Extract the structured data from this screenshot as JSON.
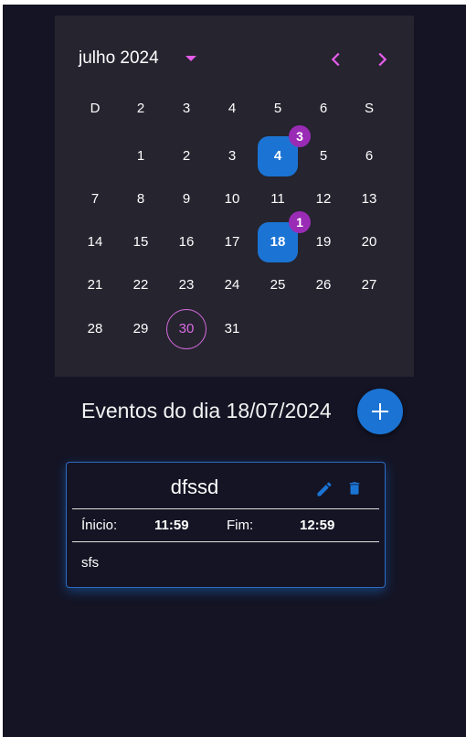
{
  "calendar": {
    "month_label": "julho 2024",
    "weekdays": [
      "D",
      "2",
      "3",
      "4",
      "5",
      "6",
      "S"
    ],
    "weeks": [
      [
        "",
        "1",
        "2",
        "3",
        "4",
        "5",
        "6"
      ],
      [
        "7",
        "8",
        "9",
        "10",
        "11",
        "12",
        "13"
      ],
      [
        "14",
        "15",
        "16",
        "17",
        "18",
        "19",
        "20"
      ],
      [
        "21",
        "22",
        "23",
        "24",
        "25",
        "26",
        "27"
      ],
      [
        "28",
        "29",
        "30",
        "31",
        "",
        "",
        ""
      ]
    ],
    "event_days": [
      {
        "day": "4",
        "count": "3"
      },
      {
        "day": "18",
        "count": "1"
      }
    ],
    "today": "30",
    "selected": "18"
  },
  "events": {
    "title": "Eventos do dia 18/07/2024",
    "add_icon": "plus-icon",
    "items": [
      {
        "title": "dfssd",
        "start_label": "Ínicio:",
        "start": "11:59",
        "end_label": "Fim:",
        "end": "12:59",
        "description": "sfs"
      }
    ]
  },
  "colors": {
    "background": "#141424",
    "calendar_bg": "#25242f",
    "accent_blue": "#1b74d4",
    "accent_pink": "#e45ce8",
    "badge_purple": "#9a2bb5"
  }
}
